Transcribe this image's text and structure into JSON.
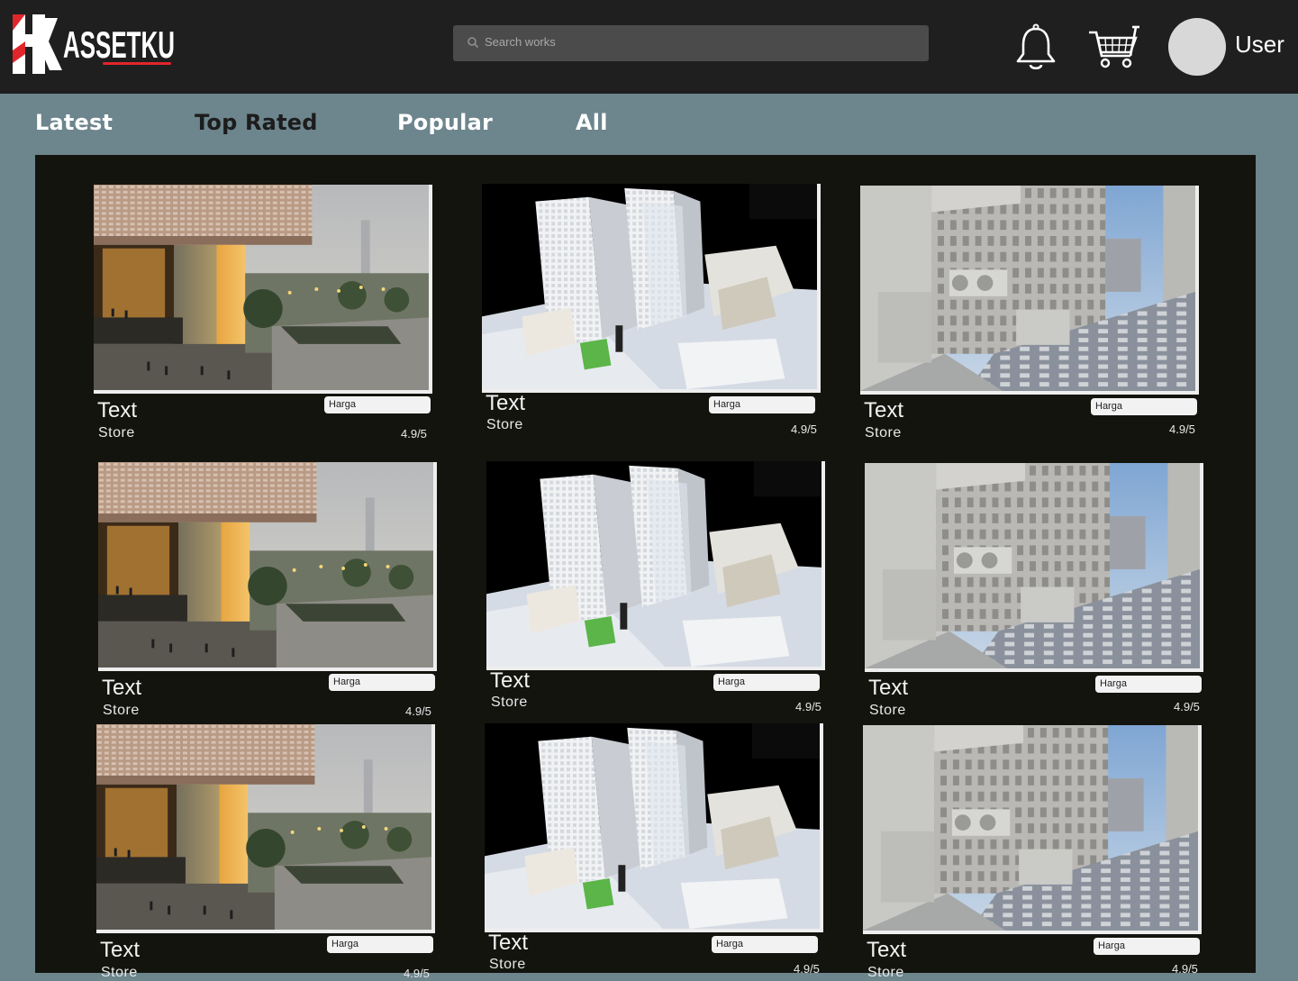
{
  "brand": {
    "name": "ASSETKU",
    "accent": "#e1262b"
  },
  "search": {
    "placeholder": "Search works"
  },
  "header": {
    "username": "User",
    "icons": [
      "bell-icon",
      "cart-icon",
      "avatar"
    ]
  },
  "tabs": [
    {
      "label": "Latest",
      "active": false
    },
    {
      "label": "Top Rated",
      "active": true
    },
    {
      "label": "Popular",
      "active": false
    },
    {
      "label": "All",
      "active": false
    }
  ],
  "cards": [
    {
      "title": "Text",
      "store": "Store",
      "price": "Harga",
      "rating": "4.9/5",
      "image": "building-night-render"
    },
    {
      "title": "Text",
      "store": "Store",
      "price": "Harga",
      "rating": "4.9/5",
      "image": "white-tower-model"
    },
    {
      "title": "Text",
      "store": "Store",
      "price": "Harga",
      "rating": "4.9/5",
      "image": "grey-alley-render"
    },
    {
      "title": "Text",
      "store": "Store",
      "price": "Harga",
      "rating": "4.9/5",
      "image": "building-night-render"
    },
    {
      "title": "Text",
      "store": "Store",
      "price": "Harga",
      "rating": "4.9/5",
      "image": "white-tower-model"
    },
    {
      "title": "Text",
      "store": "Store",
      "price": "Harga",
      "rating": "4.9/5",
      "image": "grey-alley-render"
    },
    {
      "title": "Text",
      "store": "Store",
      "price": "Harga",
      "rating": "4.9/5",
      "image": "building-night-render"
    },
    {
      "title": "Text",
      "store": "Store",
      "price": "Harga",
      "rating": "4.9/5",
      "image": "white-tower-model"
    },
    {
      "title": "Text",
      "store": "Store",
      "price": "Harga",
      "rating": "4.9/5",
      "image": "grey-alley-render"
    }
  ]
}
